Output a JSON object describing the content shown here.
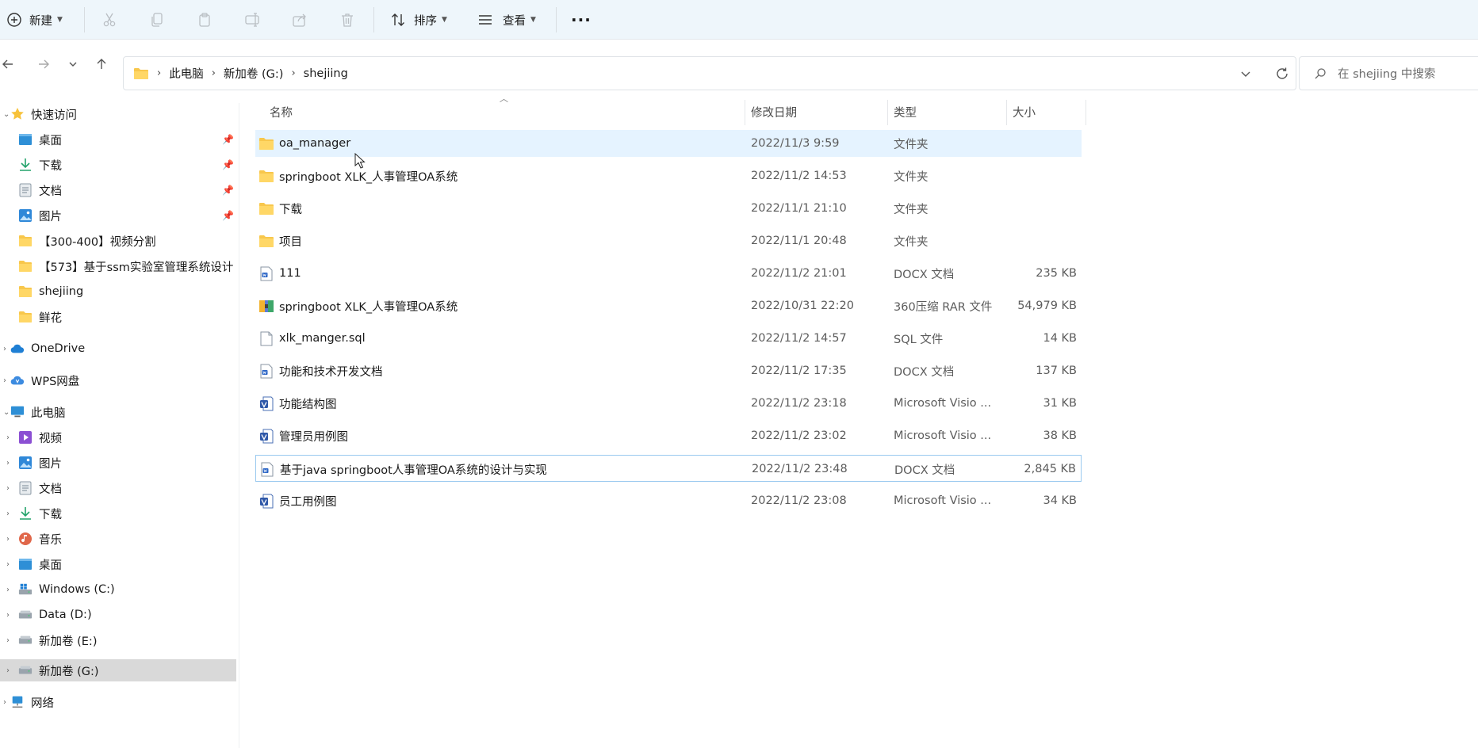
{
  "toolbar": {
    "new_label": "新建",
    "sort_label": "排序",
    "view_label": "查看",
    "more_label": "···"
  },
  "address": {
    "crumbs": [
      "此电脑",
      "新加卷 (G:)",
      "shejiing"
    ]
  },
  "search": {
    "placeholder": "在 shejiing 中搜索"
  },
  "sidebar": {
    "quick_access": "快速访问",
    "quick_items": [
      {
        "label": "桌面",
        "icon": "desktop-icon",
        "pinned": true
      },
      {
        "label": "下载",
        "icon": "download-icon",
        "pinned": true
      },
      {
        "label": "文档",
        "icon": "document-icon",
        "pinned": true
      },
      {
        "label": "图片",
        "icon": "picture-icon",
        "pinned": true
      },
      {
        "label": "【300-400】视频分割",
        "icon": "folder-icon",
        "pinned": false
      },
      {
        "label": "【573】基于ssm实验室管理系统设计",
        "icon": "folder-icon",
        "pinned": false
      },
      {
        "label": "shejiing",
        "icon": "folder-icon",
        "pinned": false
      },
      {
        "label": "鲜花",
        "icon": "folder-icon",
        "pinned": false
      }
    ],
    "onedrive": "OneDrive",
    "wps": "WPS网盘",
    "this_pc": "此电脑",
    "pc_items": [
      {
        "label": "视频",
        "icon": "video-icon"
      },
      {
        "label": "图片",
        "icon": "picture-icon"
      },
      {
        "label": "文档",
        "icon": "document-icon"
      },
      {
        "label": "下载",
        "icon": "download-icon"
      },
      {
        "label": "音乐",
        "icon": "music-icon"
      },
      {
        "label": "桌面",
        "icon": "desktop-icon"
      },
      {
        "label": "Windows (C:)",
        "icon": "windows-drive-icon"
      },
      {
        "label": "Data (D:)",
        "icon": "drive-icon"
      },
      {
        "label": "新加卷 (E:)",
        "icon": "drive-icon"
      },
      {
        "label": "新加卷 (G:)",
        "icon": "drive-icon"
      }
    ],
    "network": "网络"
  },
  "columns": {
    "name": "名称",
    "date": "修改日期",
    "type": "类型",
    "size": "大小"
  },
  "files": [
    {
      "name": "oa_manager",
      "date": "2022/11/3 9:59",
      "type": "文件夹",
      "size": "",
      "icon": "folder-icon"
    },
    {
      "name": "springboot XLK_人事管理OA系统",
      "date": "2022/11/2 14:53",
      "type": "文件夹",
      "size": "",
      "icon": "folder-icon"
    },
    {
      "name": "下载",
      "date": "2022/11/1 21:10",
      "type": "文件夹",
      "size": "",
      "icon": "folder-icon"
    },
    {
      "name": "项目",
      "date": "2022/11/1 20:48",
      "type": "文件夹",
      "size": "",
      "icon": "folder-icon"
    },
    {
      "name": "111",
      "date": "2022/11/2 21:01",
      "type": "DOCX 文档",
      "size": "235 KB",
      "icon": "docx-icon"
    },
    {
      "name": "springboot XLK_人事管理OA系统",
      "date": "2022/10/31 22:20",
      "type": "360压缩 RAR 文件",
      "size": "54,979 KB",
      "icon": "rar-icon"
    },
    {
      "name": "xlk_manger.sql",
      "date": "2022/11/2 14:57",
      "type": "SQL 文件",
      "size": "14 KB",
      "icon": "sql-file-icon"
    },
    {
      "name": "功能和技术开发文档",
      "date": "2022/11/2 17:35",
      "type": "DOCX 文档",
      "size": "137 KB",
      "icon": "docx-icon"
    },
    {
      "name": "功能结构图",
      "date": "2022/11/2 23:18",
      "type": "Microsoft Visio ...",
      "size": "31 KB",
      "icon": "visio-icon"
    },
    {
      "name": "管理员用例图",
      "date": "2022/11/2 23:02",
      "type": "Microsoft Visio ...",
      "size": "38 KB",
      "icon": "visio-icon"
    },
    {
      "name": "基于java springboot人事管理OA系统的设计与实现",
      "date": "2022/11/2 23:48",
      "type": "DOCX 文档",
      "size": "2,845 KB",
      "icon": "docx-icon"
    },
    {
      "name": "员工用例图",
      "date": "2022/11/2 23:08",
      "type": "Microsoft Visio ...",
      "size": "34 KB",
      "icon": "visio-icon"
    }
  ]
}
